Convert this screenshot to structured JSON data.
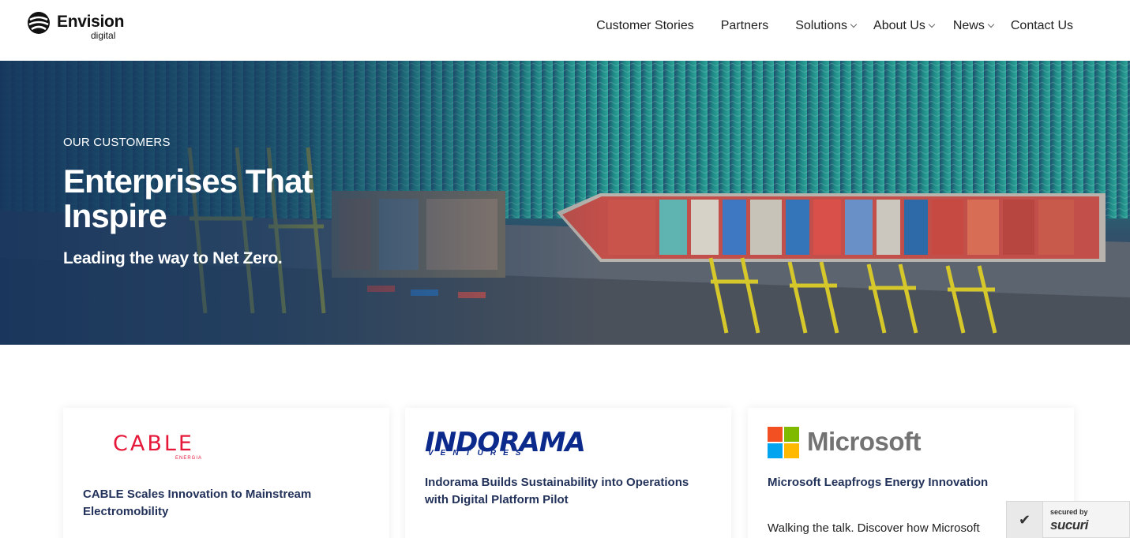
{
  "header": {
    "logo_name": "Envision",
    "logo_sub": "digital",
    "nav": [
      {
        "label": "Customer Stories",
        "dropdown": false
      },
      {
        "label": "Partners",
        "dropdown": false
      },
      {
        "label": "Solutions",
        "dropdown": true
      },
      {
        "label": "About Us",
        "dropdown": true
      },
      {
        "label": "News",
        "dropdown": true
      },
      {
        "label": "Contact Us",
        "dropdown": false
      }
    ]
  },
  "hero": {
    "eyebrow": "OUR CUSTOMERS",
    "title": "Enterprises That Inspire",
    "subtitle": "Leading the way to Net Zero."
  },
  "cards": [
    {
      "logo_text": "CABLE",
      "logo_sub": "ENERGIA",
      "title": "CABLE Scales Innovation to Mainstream Electromobility",
      "text": ""
    },
    {
      "logo_text": "INDORAMA",
      "logo_sub": "VENTURES",
      "title": "Indorama Builds Sustainability into Operations with Digital Platform Pilot",
      "text": ""
    },
    {
      "logo_text": "Microsoft",
      "logo_sub": "",
      "title": "Microsoft Leapfrogs Energy Innovation",
      "text": "Walking the talk. Discover how Microsoft"
    }
  ],
  "badge": {
    "secured_by": "secured by",
    "brand": "sucuri"
  },
  "colors": {
    "title_navy": "#23325a",
    "cable_red": "#e6183a",
    "indorama_blue": "#0c2a8c",
    "ms_red": "#f25022",
    "ms_green": "#7fba00",
    "ms_blue": "#00a4ef",
    "ms_yellow": "#ffb900"
  }
}
